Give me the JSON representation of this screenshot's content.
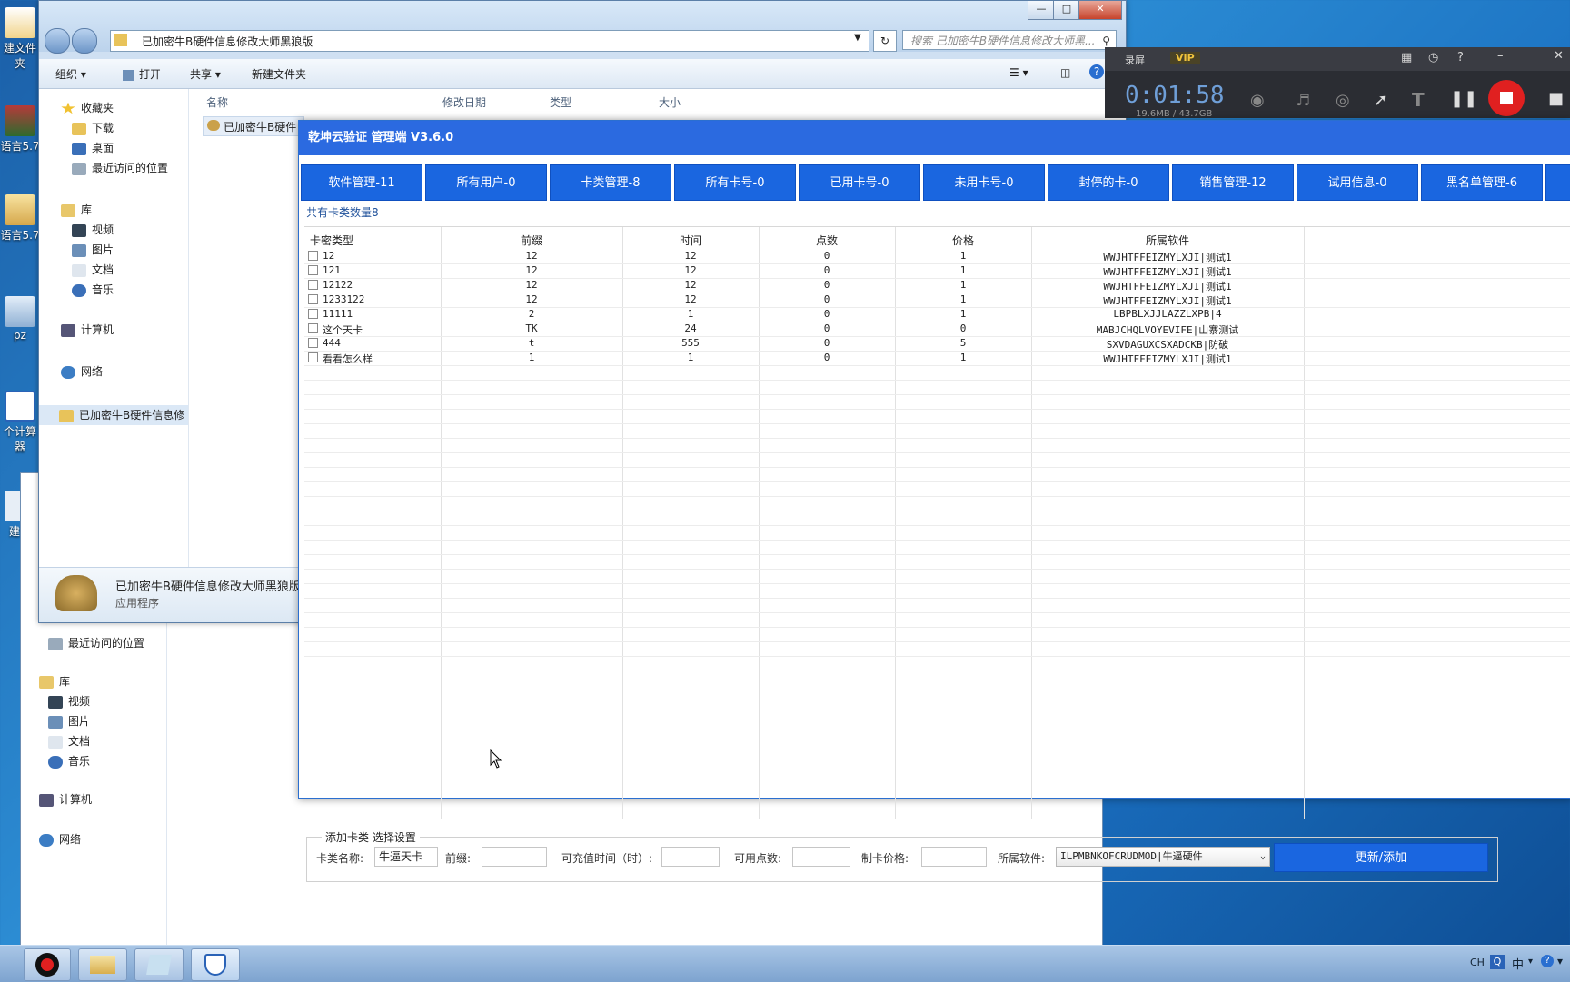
{
  "desktop": {
    "icons": [
      {
        "label": "建文件夹"
      },
      {
        "label": "语言5.7"
      },
      {
        "label": "语言5.7"
      },
      {
        "label": "pz"
      },
      {
        "label": "个计算器"
      },
      {
        "label": "建文"
      }
    ]
  },
  "explorer": {
    "path": "已加密牛B硬件信息修改大师黑狼版",
    "search_placeholder": "搜索 已加密牛B硬件信息修改大师黑...",
    "toolbar": {
      "organize": "组织",
      "open": "打开",
      "share": "共享",
      "new_folder": "新建文件夹"
    },
    "columns": {
      "name": "名称",
      "modified": "修改日期",
      "type": "类型",
      "size": "大小"
    },
    "file_name": "已加密牛B硬件",
    "nav": {
      "favorites": "收藏夹",
      "downloads": "下载",
      "desktop": "桌面",
      "recent": "最近访问的位置",
      "library": "库",
      "videos": "视频",
      "pictures": "图片",
      "documents": "文档",
      "music": "音乐",
      "computer": "计算机",
      "network": "网络",
      "folder": "已加密牛B硬件信息修"
    },
    "details": {
      "name": "已加密牛B硬件信息修改大师黑狼版",
      "type": "应用程序"
    }
  },
  "explorer_back": {
    "nav": {
      "recent": "最近访问的位置",
      "library": "库",
      "videos": "视频",
      "pictures": "图片",
      "documents": "文档",
      "music": "音乐",
      "computer": "计算机",
      "network": "网络"
    }
  },
  "recorder": {
    "label": "录屏",
    "vip": "VIP",
    "time": "0:01:58",
    "size": "19.6MB / 43.7GB"
  },
  "app": {
    "title": "乾坤云验证 管理端 V3.6.0",
    "tabs": [
      "软件管理-11",
      "所有用户-0",
      "卡类管理-8",
      "所有卡号-0",
      "已用卡号-0",
      "未用卡号-0",
      "封停的卡-0",
      "销售管理-12",
      "试用信息-0",
      "黑名单管理-6"
    ],
    "count_text": "共有卡类数量8",
    "columns": [
      "卡密类型",
      "前缀",
      "时间",
      "点数",
      "价格",
      "所属软件"
    ],
    "rows": [
      {
        "type": "12",
        "prefix": "12",
        "time": "12",
        "points": "0",
        "price": "1",
        "software": "WWJHTFFEIZMYLXJI|测试1"
      },
      {
        "type": "121",
        "prefix": "12",
        "time": "12",
        "points": "0",
        "price": "1",
        "software": "WWJHTFFEIZMYLXJI|测试1"
      },
      {
        "type": "12122",
        "prefix": "12",
        "time": "12",
        "points": "0",
        "price": "1",
        "software": "WWJHTFFEIZMYLXJI|测试1"
      },
      {
        "type": "1233122",
        "prefix": "12",
        "time": "12",
        "points": "0",
        "price": "1",
        "software": "WWJHTFFEIZMYLXJI|测试1"
      },
      {
        "type": "11111",
        "prefix": "2",
        "time": "1",
        "points": "0",
        "price": "1",
        "software": "LBPBLXJJLAZZLXPB|4"
      },
      {
        "type": "这个天卡",
        "prefix": "TK",
        "time": "24",
        "points": "0",
        "price": "0",
        "software": "MABJCHQLVOYEVIFE|山寨测试"
      },
      {
        "type": "444",
        "prefix": "t",
        "time": "555",
        "points": "0",
        "price": "5",
        "software": "SXVDAGUXCSXADCKB|防破"
      },
      {
        "type": "看看怎么样",
        "prefix": "1",
        "time": "1",
        "points": "0",
        "price": "1",
        "software": "WWJHTFFEIZMYLXJI|测试1"
      }
    ],
    "form": {
      "legend": "添加卡类 选择设置",
      "name_label": "卡类名称:",
      "name_value": "牛逼天卡",
      "prefix_label": "前缀:",
      "prefix_value": "",
      "time_label": "可充值时间（时）:",
      "time_value": "",
      "points_label": "可用点数:",
      "points_value": "",
      "price_label": "制卡价格:",
      "price_value": "",
      "software_label": "所属软件:",
      "software_value": "ILPMBNKOFCRUDMOD|牛逼硬件",
      "submit_label": "更新/添加"
    }
  },
  "taskbar": {
    "lang": "CH",
    "ime": "中"
  },
  "colors": {
    "accent": "#1a66e0",
    "title": "#2b6ae0",
    "record": "#e02020"
  }
}
